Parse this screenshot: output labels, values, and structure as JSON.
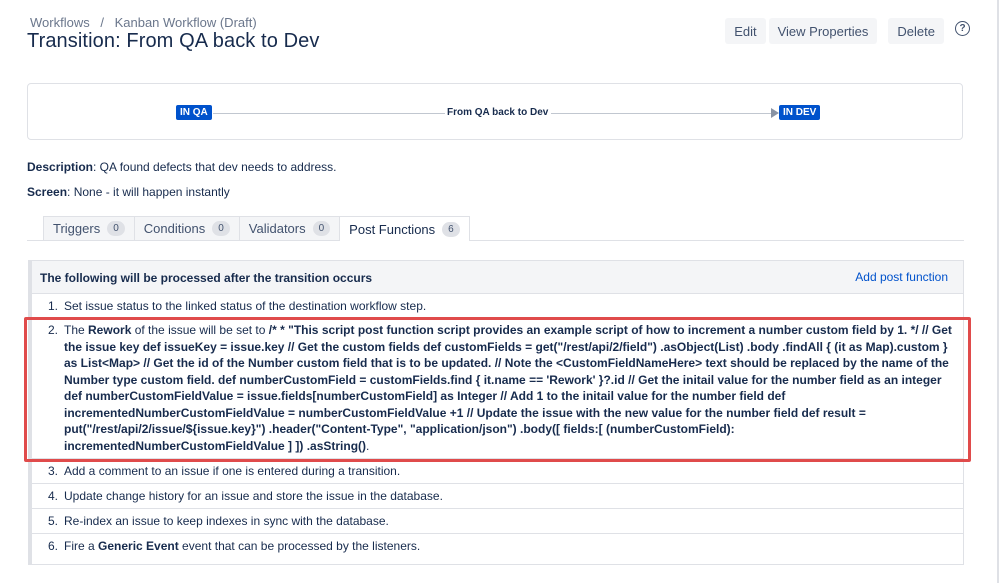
{
  "breadcrumb": {
    "parent": "Workflows",
    "separator": "/",
    "current": "Kanban Workflow (Draft)"
  },
  "page_title": "Transition: From QA back to Dev",
  "actions": {
    "edit": "Edit",
    "view_properties": "View Properties",
    "delete": "Delete",
    "help": "?"
  },
  "diagram": {
    "from_status": "IN QA",
    "transition": "From QA back to Dev",
    "to_status": "IN DEV"
  },
  "description": {
    "label": "Description",
    "text": ": QA found defects that dev needs to address."
  },
  "screen": {
    "label": "Screen",
    "text": ": None - it will happen instantly"
  },
  "tabs": [
    {
      "label": "Triggers",
      "count": "0"
    },
    {
      "label": "Conditions",
      "count": "0"
    },
    {
      "label": "Validators",
      "count": "0"
    },
    {
      "label": "Post Functions",
      "count": "6"
    }
  ],
  "panel": {
    "title": "The following will be processed after the transition occurs",
    "add_link": "Add post function"
  },
  "post_functions": [
    {
      "num": "1.",
      "text": "Set issue status to the linked status of the destination workflow step."
    },
    {
      "num": "2.",
      "prefix": "The ",
      "field": "Rework",
      "middle": " of the issue will be set to ",
      "script": "/* * \"This script post function script provides an example script of how to increment a number custom field by 1. */ // Get the issue key def issueKey = issue.key // Get the custom fields def customFields = get(\"/rest/api/2/field\") .asObject(List) .body .findAll { (it as Map).custom } as List<Map> // Get the id of the Number custom field that is to be updated. // Note the <CustomFieldNameHere> text should be replaced by the name of the Number type custom field. def numberCustomField = customFields.find { it.name == 'Rework' }?.id // Get the initail value for the number field as an integer def numberCustomFieldValue = issue.fields[numberCustomField] as Integer // Add 1 to the initail value for the number field def incrementedNumberCustomFieldValue = numberCustomFieldValue +1 // Update the issue with the new value for the number field def result = put(\"/rest/api/2/issue/${issue.key}\") .header(\"Content-Type\", \"application/json\") .body([ fields:[ (numberCustomField): incrementedNumberCustomFieldValue ] ]) .asString()",
      "suffix": "."
    },
    {
      "num": "3.",
      "text": "Add a comment to an issue if one is entered during a transition."
    },
    {
      "num": "4.",
      "text": "Update change history for an issue and store the issue in the database."
    },
    {
      "num": "5.",
      "text": "Re-index an issue to keep indexes in sync with the database."
    },
    {
      "num": "6.",
      "prefix": "Fire a ",
      "event": "Generic Event",
      "suffix": " event that can be processed by the listeners."
    }
  ],
  "colors": {
    "link": "#0052cc",
    "status": "#0052cc",
    "highlight": "#e04b4b",
    "text": "#172b4d"
  }
}
